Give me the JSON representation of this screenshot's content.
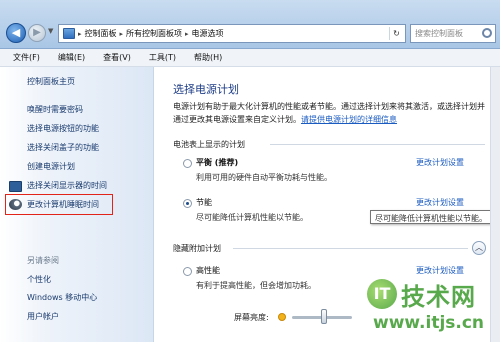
{
  "address": {
    "crumbs": [
      "控制面板",
      "所有控制面板项",
      "电源选项"
    ],
    "search_placeholder": "搜索控制面板"
  },
  "menu": [
    "文件(F)",
    "编辑(E)",
    "查看(V)",
    "工具(T)",
    "帮助(H)"
  ],
  "sidebar": {
    "home": "控制面板主页",
    "links": [
      "唤醒时需要密码",
      "选择电源按钮的功能",
      "选择关闭盖子的功能",
      "创建电源计划",
      "选择关闭显示器的时间",
      "更改计算机睡眠时间"
    ],
    "see_also_title": "另请参阅",
    "see_also": [
      "个性化",
      "Windows 移动中心",
      "用户帐户"
    ]
  },
  "main": {
    "title": "选择电源计划",
    "desc_text": "电源计划有助于最大化计算机的性能或者节能。通过选择计划来将其激活，或选择计划并通过更改其电源设置来自定义计划。",
    "desc_link": "请提供电源计划的详细信息",
    "battery_section": "电池表上显示的计划",
    "hidden_section": "隐藏附加计划",
    "change_link": "更改计划设置",
    "plans": [
      {
        "name": "平衡 (推荐)",
        "desc": "利用可用的硬件自动平衡功耗与性能。",
        "selected": false
      },
      {
        "name": "节能",
        "desc": "尽可能降低计算机性能以节能。",
        "selected": true
      },
      {
        "name": "高性能",
        "desc": "有利于提高性能，但会增加功耗。",
        "selected": false
      }
    ],
    "tooltip": "尽可能降低计算机性能以节能。",
    "brightness_label": "屏幕亮度:",
    "brightness_level": 0.53
  },
  "watermark": {
    "logo": "IT",
    "text": "技术网",
    "url": "www.itjs.cn"
  }
}
